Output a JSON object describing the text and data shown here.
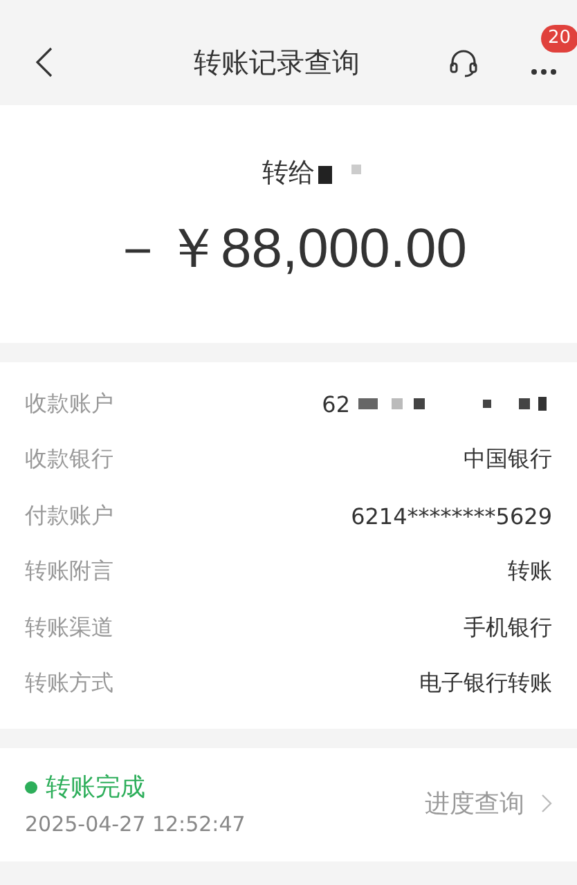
{
  "header": {
    "title": "转账记录查询",
    "badge": "20"
  },
  "summary": {
    "recipient": "转给",
    "amount": "－￥88,000.00"
  },
  "details": [
    {
      "label": "收款账户",
      "value": "62",
      "redacted": true
    },
    {
      "label": "收款银行",
      "value": "中国银行",
      "redacted": false
    },
    {
      "label": "付款账户",
      "value": "6214********5629",
      "redacted": false
    },
    {
      "label": "转账附言",
      "value": "转账",
      "redacted": false
    },
    {
      "label": "转账渠道",
      "value": "手机银行",
      "redacted": false
    },
    {
      "label": "转账方式",
      "value": "电子银行转账",
      "redacted": false
    }
  ],
  "status": {
    "text": "转账完成",
    "time": "2025-04-27 12:52:47",
    "link": "进度查询"
  }
}
